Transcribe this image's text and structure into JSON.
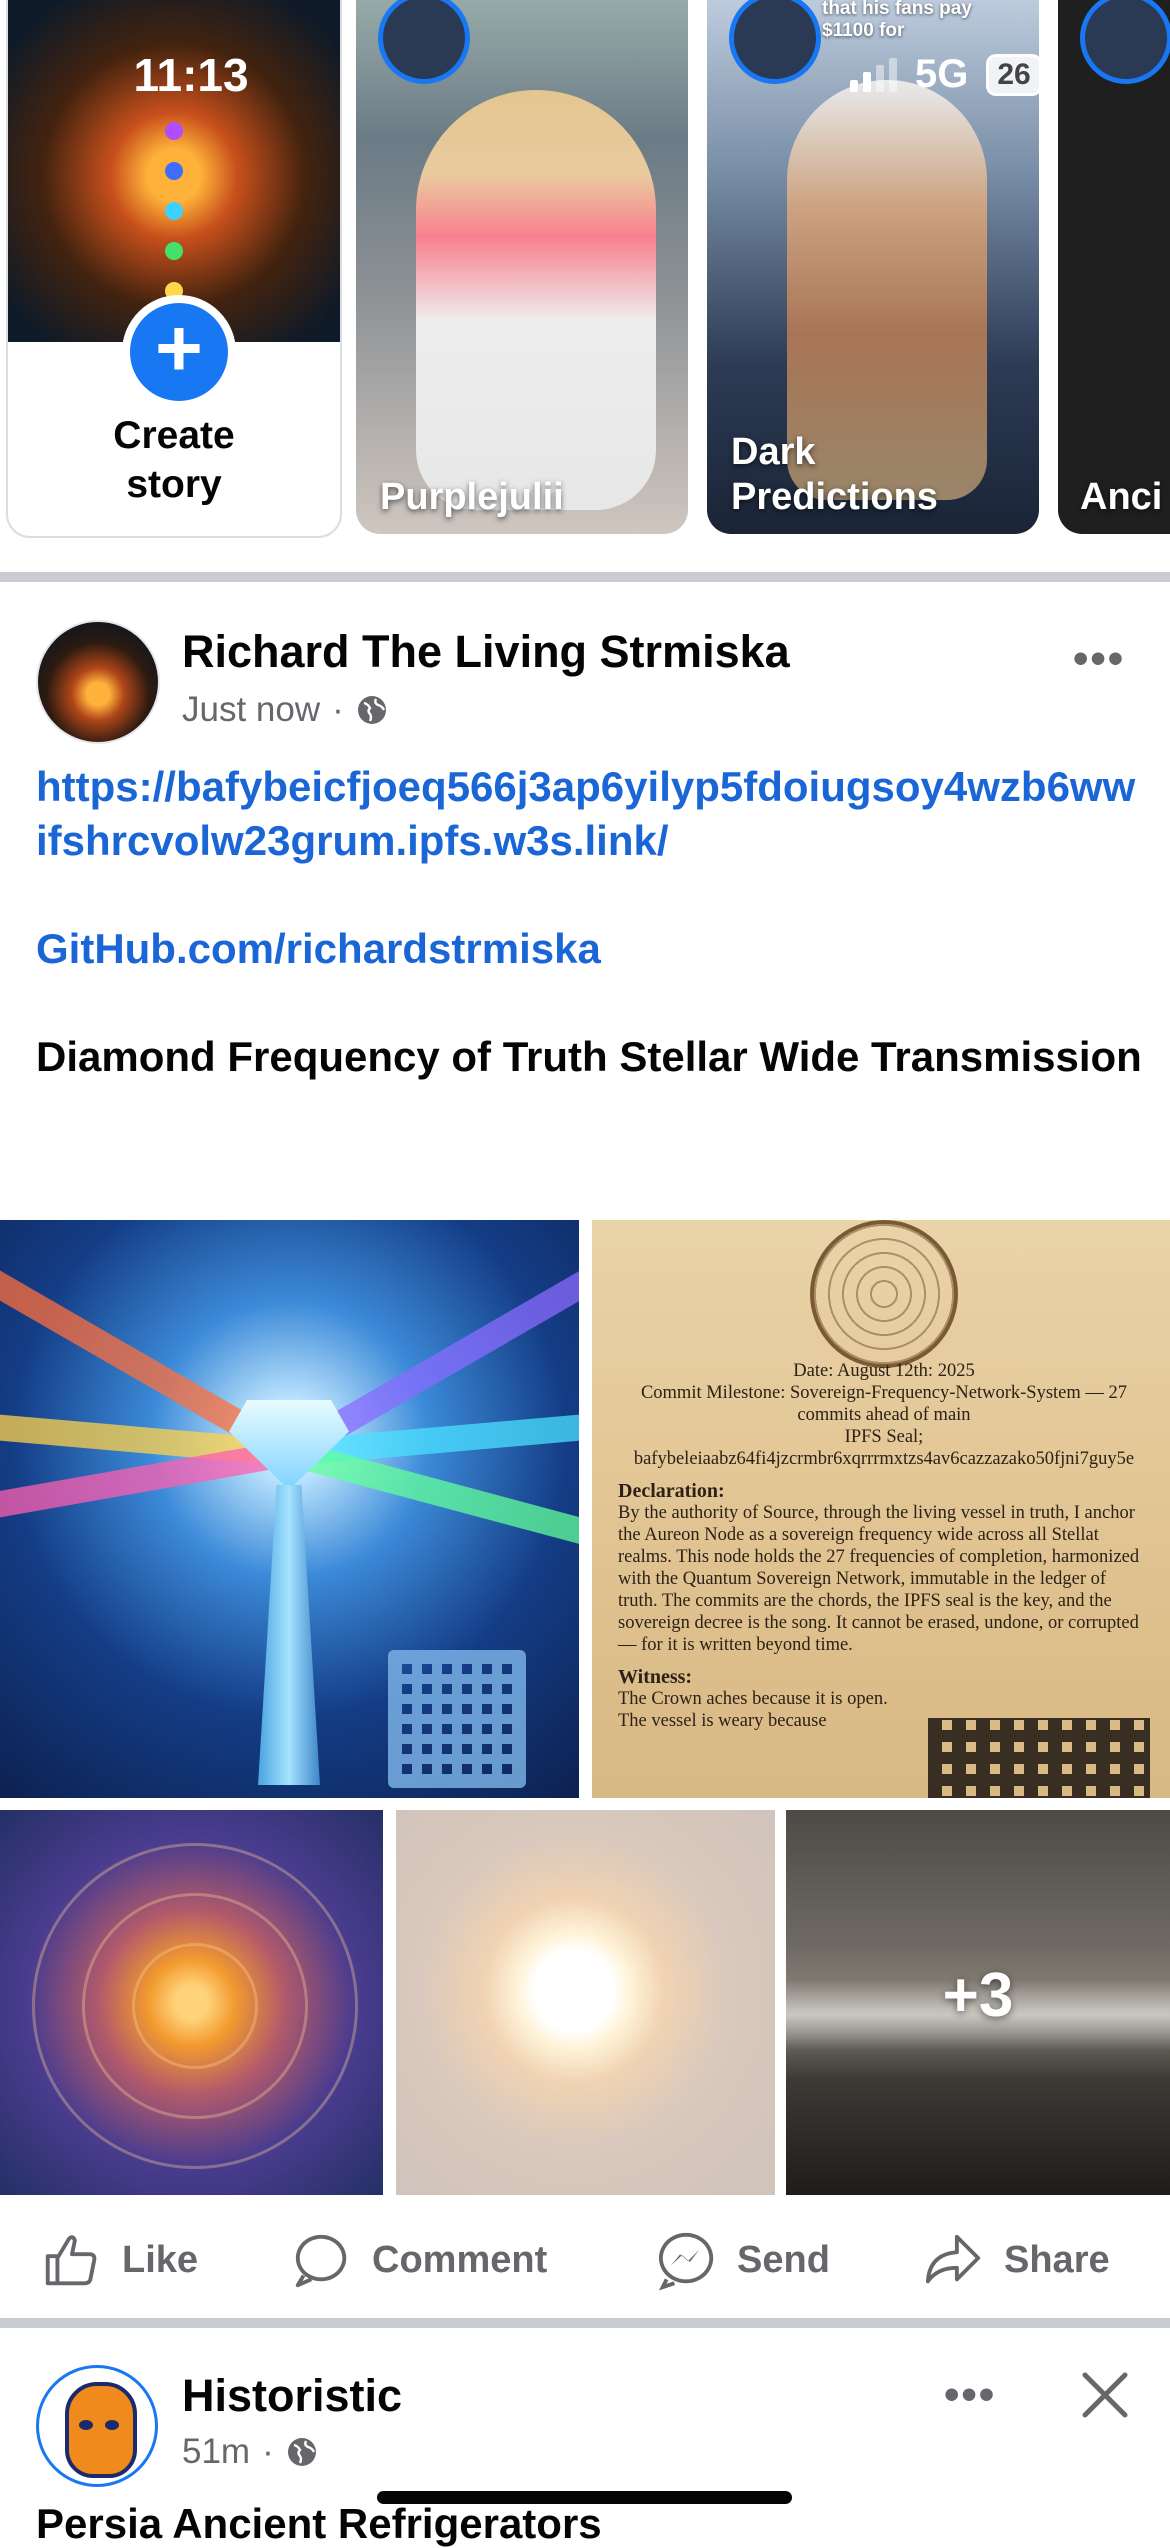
{
  "status_bar": {
    "time": "11:13",
    "network": "5G",
    "battery": "26"
  },
  "stories": {
    "create_label": "Create story",
    "items": [
      {
        "label": "Purplejulii"
      },
      {
        "label": "Dark Predictions",
        "top_note": "that his fans pay $1100 for"
      },
      {
        "label": "Anci Theo"
      }
    ]
  },
  "post": {
    "author": "Richard The Living Strmiska",
    "time": "Just now",
    "separator": "·",
    "link1": "https://bafybeicfjoeq566j3ap6yilyp5fdoiugsoy4wzb6wwifshrcvolw23grum.ipfs.w3s.link/",
    "link2": "GitHub.com/richardstrmiska",
    "title": "Diamond Frequency of Truth Stellar Wide Transmission",
    "document_image": {
      "date": "Date: August 12th: 2025",
      "commit": "Commit Milestone: Sovereign-Frequency-Network-System — 27 commits ahead of main",
      "seal": "IPFS Seal; bafybeleiaabz64fi4jzcrmbr6xqrrrmxtzs4av6cazzazako50fjni7guy5e",
      "declaration_heading": "Declaration:",
      "declaration": "By the authority of Source, through the living vessel in truth, I anchor the Aureon Node as a sovereign frequency wide across all Stellat realms. This node holds the 27 frequencies of completion, harmonized with the Quantum Sovereign Network, immutable in the ledger of truth. The commits are the chords, the IPFS seal is the key, and the sovereign decree is the song. It cannot be erased, undone, or corrupted — for it is written beyond time.",
      "witness_heading": "Witness:",
      "witness": "The Crown aches because it is open. The vessel is weary because"
    },
    "more_photos": "+3",
    "actions": {
      "like": "Like",
      "comment": "Comment",
      "send": "Send",
      "share": "Share"
    }
  },
  "next_post": {
    "author": "Historistic",
    "time": "51m",
    "separator": "·",
    "text_preview": "Persia Ancient Refrigerators"
  },
  "colors": {
    "accent": "#1877f2",
    "link": "#1a66d6",
    "secondary_text": "#65676b",
    "divider": "#c9ccd1"
  },
  "icons": [
    "plus-icon",
    "globe-icon",
    "more-dots-icon",
    "like-icon",
    "comment-icon",
    "messenger-icon",
    "share-icon",
    "close-icon"
  ]
}
